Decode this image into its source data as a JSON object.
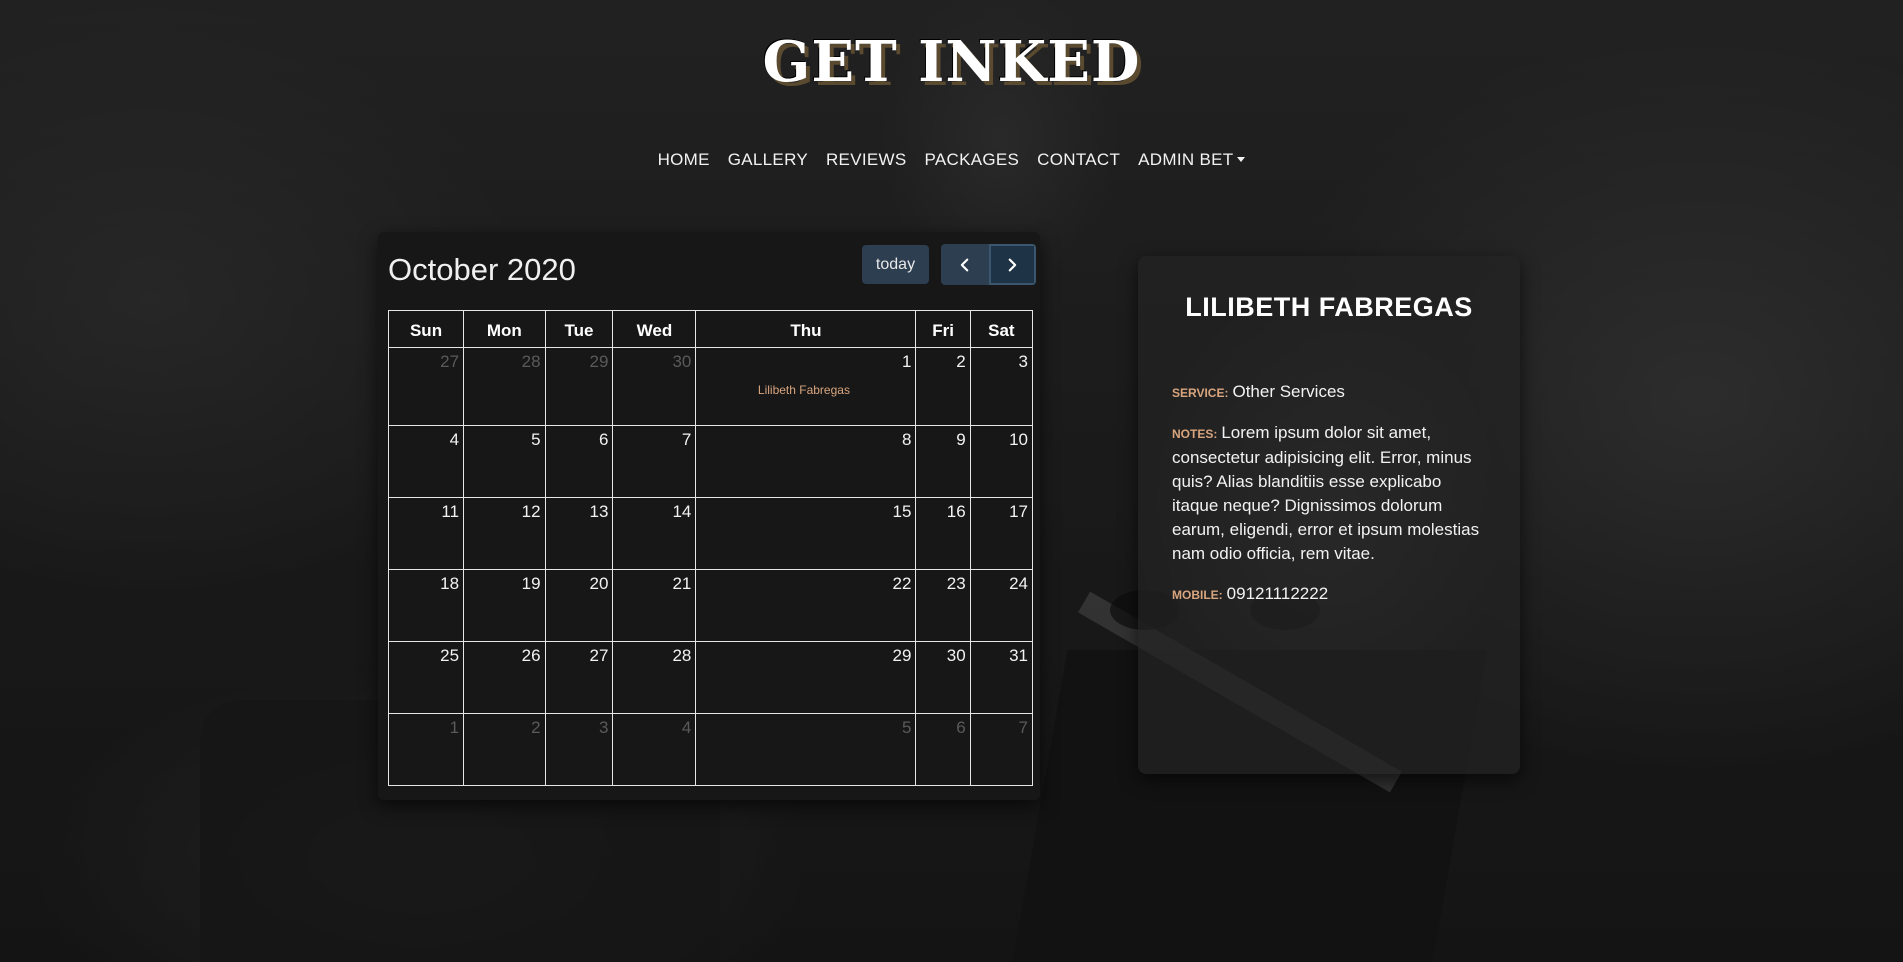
{
  "brand": {
    "logo": "GET INKED"
  },
  "nav": {
    "items": [
      "HOME",
      "GALLERY",
      "REVIEWS",
      "PACKAGES",
      "CONTACT"
    ],
    "admin_label": "ADMIN BET"
  },
  "calendar": {
    "title": "October 2020",
    "today_label": "today",
    "prev_icon": "chevron-left-icon",
    "next_icon": "chevron-right-icon",
    "weekdays": [
      "Sun",
      "Mon",
      "Tue",
      "Wed",
      "Thu",
      "Fri",
      "Sat"
    ],
    "weeks": [
      [
        "27",
        "28",
        "29",
        "30",
        "1",
        "2",
        "3"
      ],
      [
        "4",
        "5",
        "6",
        "7",
        "8",
        "9",
        "10"
      ],
      [
        "11",
        "12",
        "13",
        "14",
        "15",
        "16",
        "17"
      ],
      [
        "18",
        "19",
        "20",
        "21",
        "22",
        "23",
        "24"
      ],
      [
        "25",
        "26",
        "27",
        "28",
        "29",
        "30",
        "31"
      ],
      [
        "1",
        "2",
        "3",
        "4",
        "5",
        "6",
        "7"
      ]
    ],
    "event": {
      "date": "1",
      "title": "Lilibeth Fabregas",
      "color": "#d9a57f"
    },
    "accent_button_color": "#2c3e50"
  },
  "profile": {
    "name": "LILIBETH FABREGAS",
    "service_label": "SERVICE:",
    "service": "Other Services",
    "notes_label": "NOTES:",
    "notes": "Lorem ipsum dolor sit amet, consectetur adipisicing elit. Error, minus quis? Alias blanditiis esse explicabo itaque neque? Dignissimos dolorum earum, eligendi, error et ipsum molestias nam odio officia, rem vitae.",
    "mobile_label": "MOBILE:",
    "mobile": "09121112222"
  }
}
